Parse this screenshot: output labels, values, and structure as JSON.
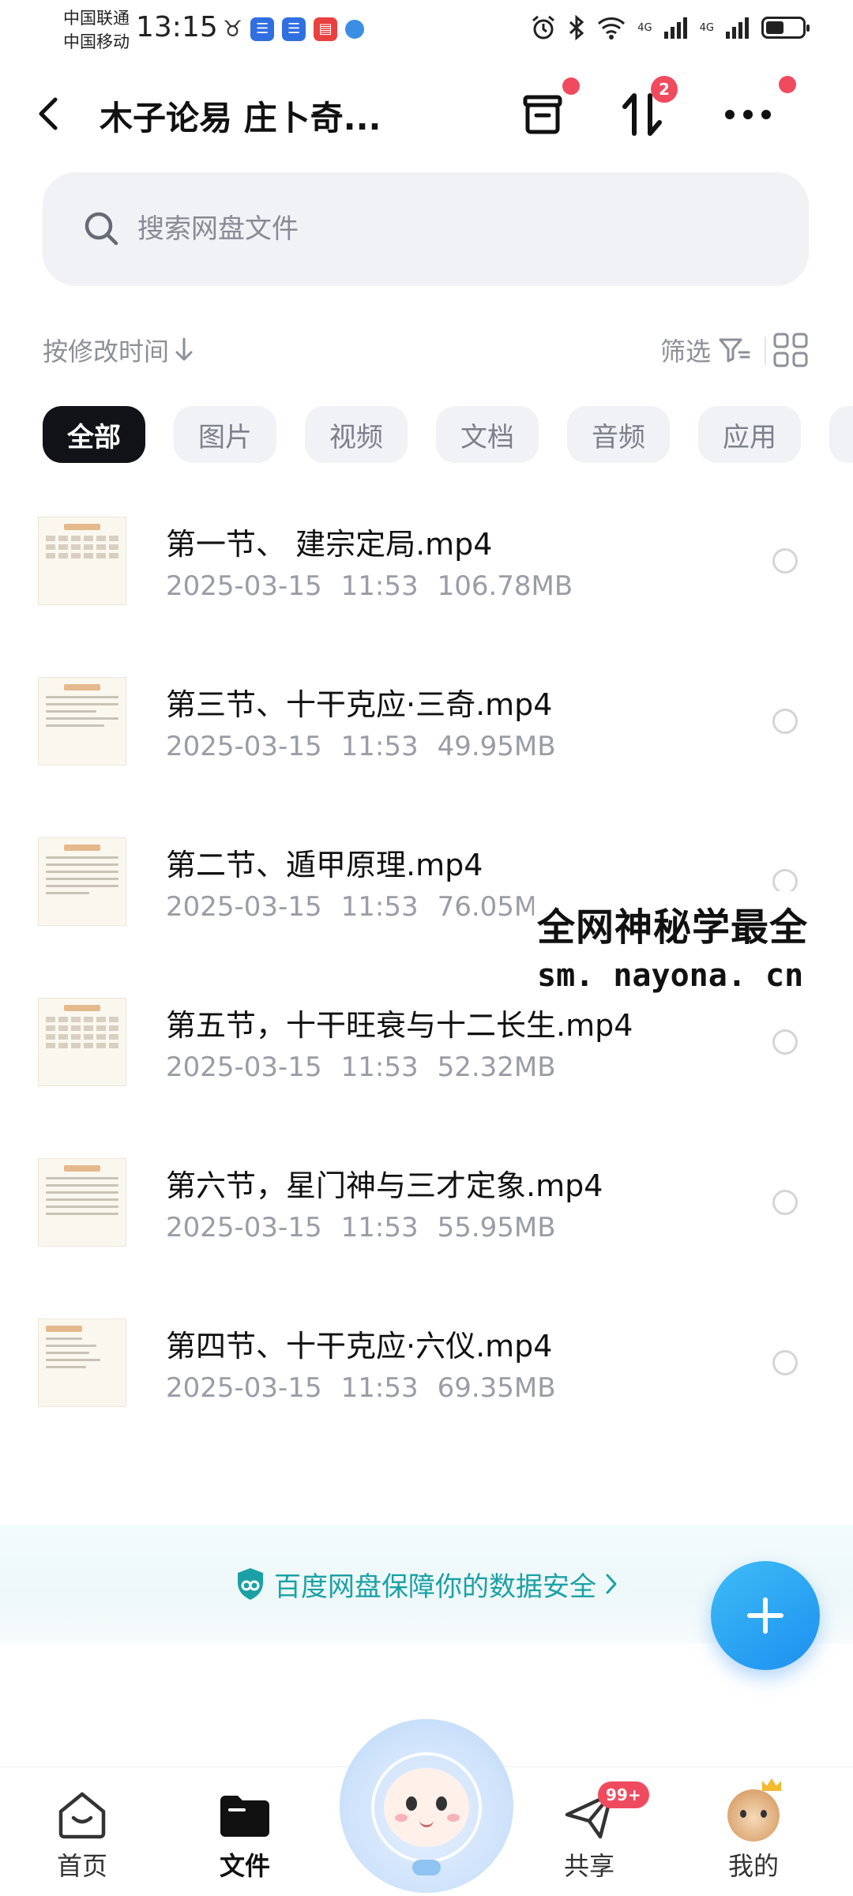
{
  "status_bar": {
    "carrier1": "中国联通",
    "carrier2": "中国移动",
    "time": "13:15",
    "net1": "4G",
    "net2": "4G",
    "battery_level": 0.5
  },
  "header": {
    "title": "木子论易 庄卜奇...",
    "transfer_badge": "2"
  },
  "search": {
    "placeholder": "搜索网盘文件"
  },
  "sort": {
    "label": "按修改时间",
    "filter_label": "筛选"
  },
  "chips": [
    {
      "label": "全部",
      "active": true
    },
    {
      "label": "图片",
      "active": false
    },
    {
      "label": "视频",
      "active": false
    },
    {
      "label": "文档",
      "active": false
    },
    {
      "label": "音频",
      "active": false
    },
    {
      "label": "应用",
      "active": false
    }
  ],
  "files": [
    {
      "name": "第一节、 建宗定局.mp4",
      "date": "2025-03-15",
      "time": "11:53",
      "size": "106.78MB"
    },
    {
      "name": "第三节、十干克应·三奇.mp4",
      "date": "2025-03-15",
      "time": "11:53",
      "size": "49.95MB"
    },
    {
      "name": "第二节、遁甲原理.mp4",
      "date": "2025-03-15",
      "time": "11:53",
      "size": "76.05MB"
    },
    {
      "name": "第五节，十干旺衰与十二长生.mp4",
      "date": "2025-03-15",
      "time": "11:53",
      "size": "52.32MB"
    },
    {
      "name": "第六节，星门神与三才定象.mp4",
      "date": "2025-03-15",
      "time": "11:53",
      "size": "55.95MB"
    },
    {
      "name": "第四节、十干克应·六仪.mp4",
      "date": "2025-03-15",
      "time": "11:53",
      "size": "69.35MB"
    }
  ],
  "watermark": {
    "line1": "全网神秘学最全",
    "line2": "sm. nayona. cn"
  },
  "banner": {
    "text": "百度网盘保障你的数据安全"
  },
  "nav": {
    "home": "首页",
    "files": "文件",
    "share": "共享",
    "share_badge": "99+",
    "mine": "我的"
  },
  "colors": {
    "accent": "#1d8ff0",
    "badge": "#f04a5f",
    "security": "#1ba1a5"
  }
}
